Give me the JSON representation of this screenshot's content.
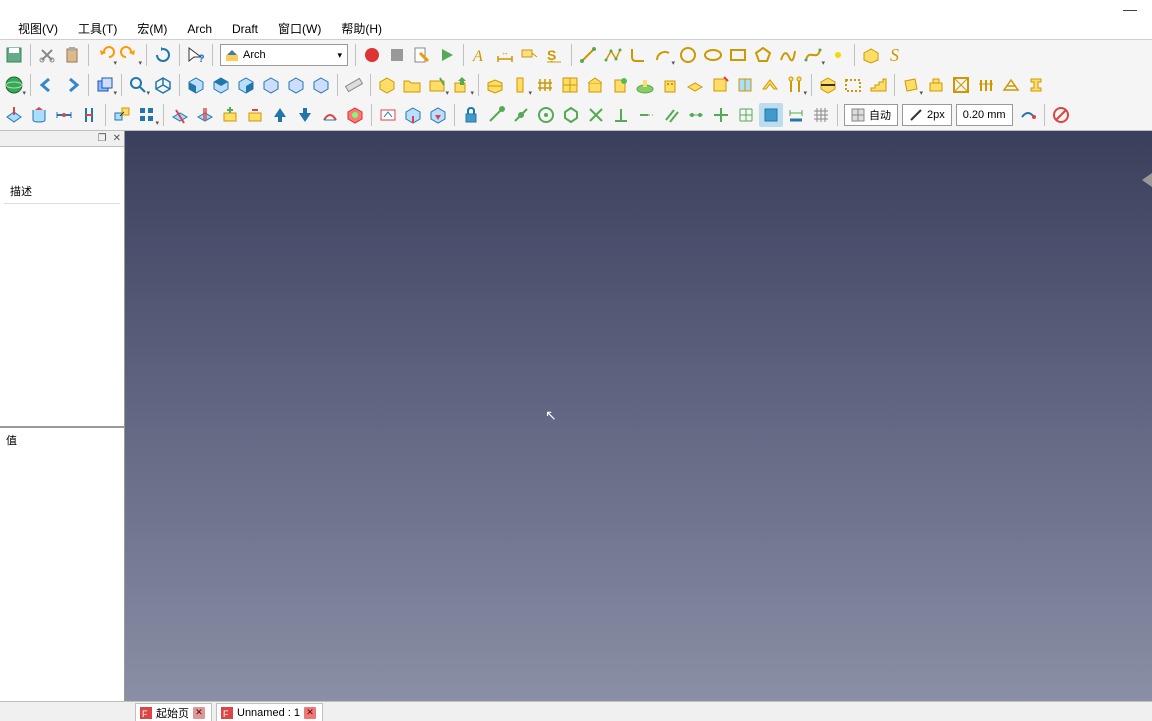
{
  "menu": {
    "view": "视图(V)",
    "tools": "工具(T)",
    "macro": "宏(M)",
    "arch": "Arch",
    "draft": "Draft",
    "window": "窗口(W)",
    "help": "帮助(H)"
  },
  "workbench": {
    "label": "Arch"
  },
  "snap": {
    "auto": "自动",
    "px": "2px",
    "mm": "0.20 mm"
  },
  "panel": {
    "tree_header": "描述",
    "prop_header": "值"
  },
  "tabs": {
    "start": "起始页",
    "doc": "Unnamed : 1"
  }
}
